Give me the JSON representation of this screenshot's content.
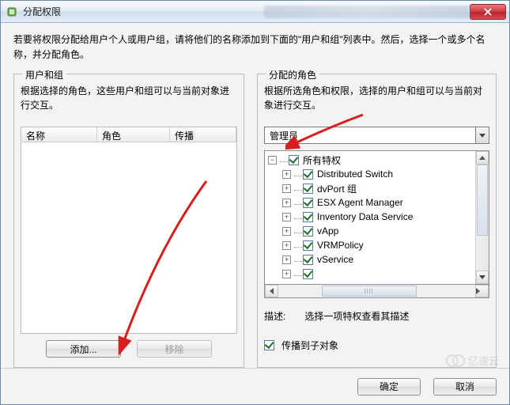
{
  "window": {
    "title": "分配权限"
  },
  "intro": "若要将权限分配给用户个人或用户组，请将他们的名称添加到下面的\"用户和组\"列表中。然后，选择一个或多个名称，并分配角色。",
  "left_group": {
    "title": "用户和组",
    "desc": "根据选择的角色，这些用户和组可以与当前对象进行交互。",
    "columns": {
      "name": "名称",
      "role": "角色",
      "propagate": "传播"
    },
    "add": "添加...",
    "remove": "移除"
  },
  "right_group": {
    "title": "分配的角色",
    "desc": "根据所选角色和权限，选择的用户和组可以与当前对象进行交互。",
    "role_value": "管理员",
    "tree_root": "所有特权",
    "tree_items": [
      "Distributed Switch",
      "dvPort 组",
      "ESX Agent Manager",
      "Inventory Data Service",
      "vApp",
      "VRMPolicy",
      "vService"
    ],
    "desc_label": "描述:",
    "desc_value": "选择一项特权查看其描述",
    "propagate_label": "传播到子对象"
  },
  "footer": {
    "ok": "确定",
    "cancel": "取消"
  },
  "watermark": "亿速云"
}
